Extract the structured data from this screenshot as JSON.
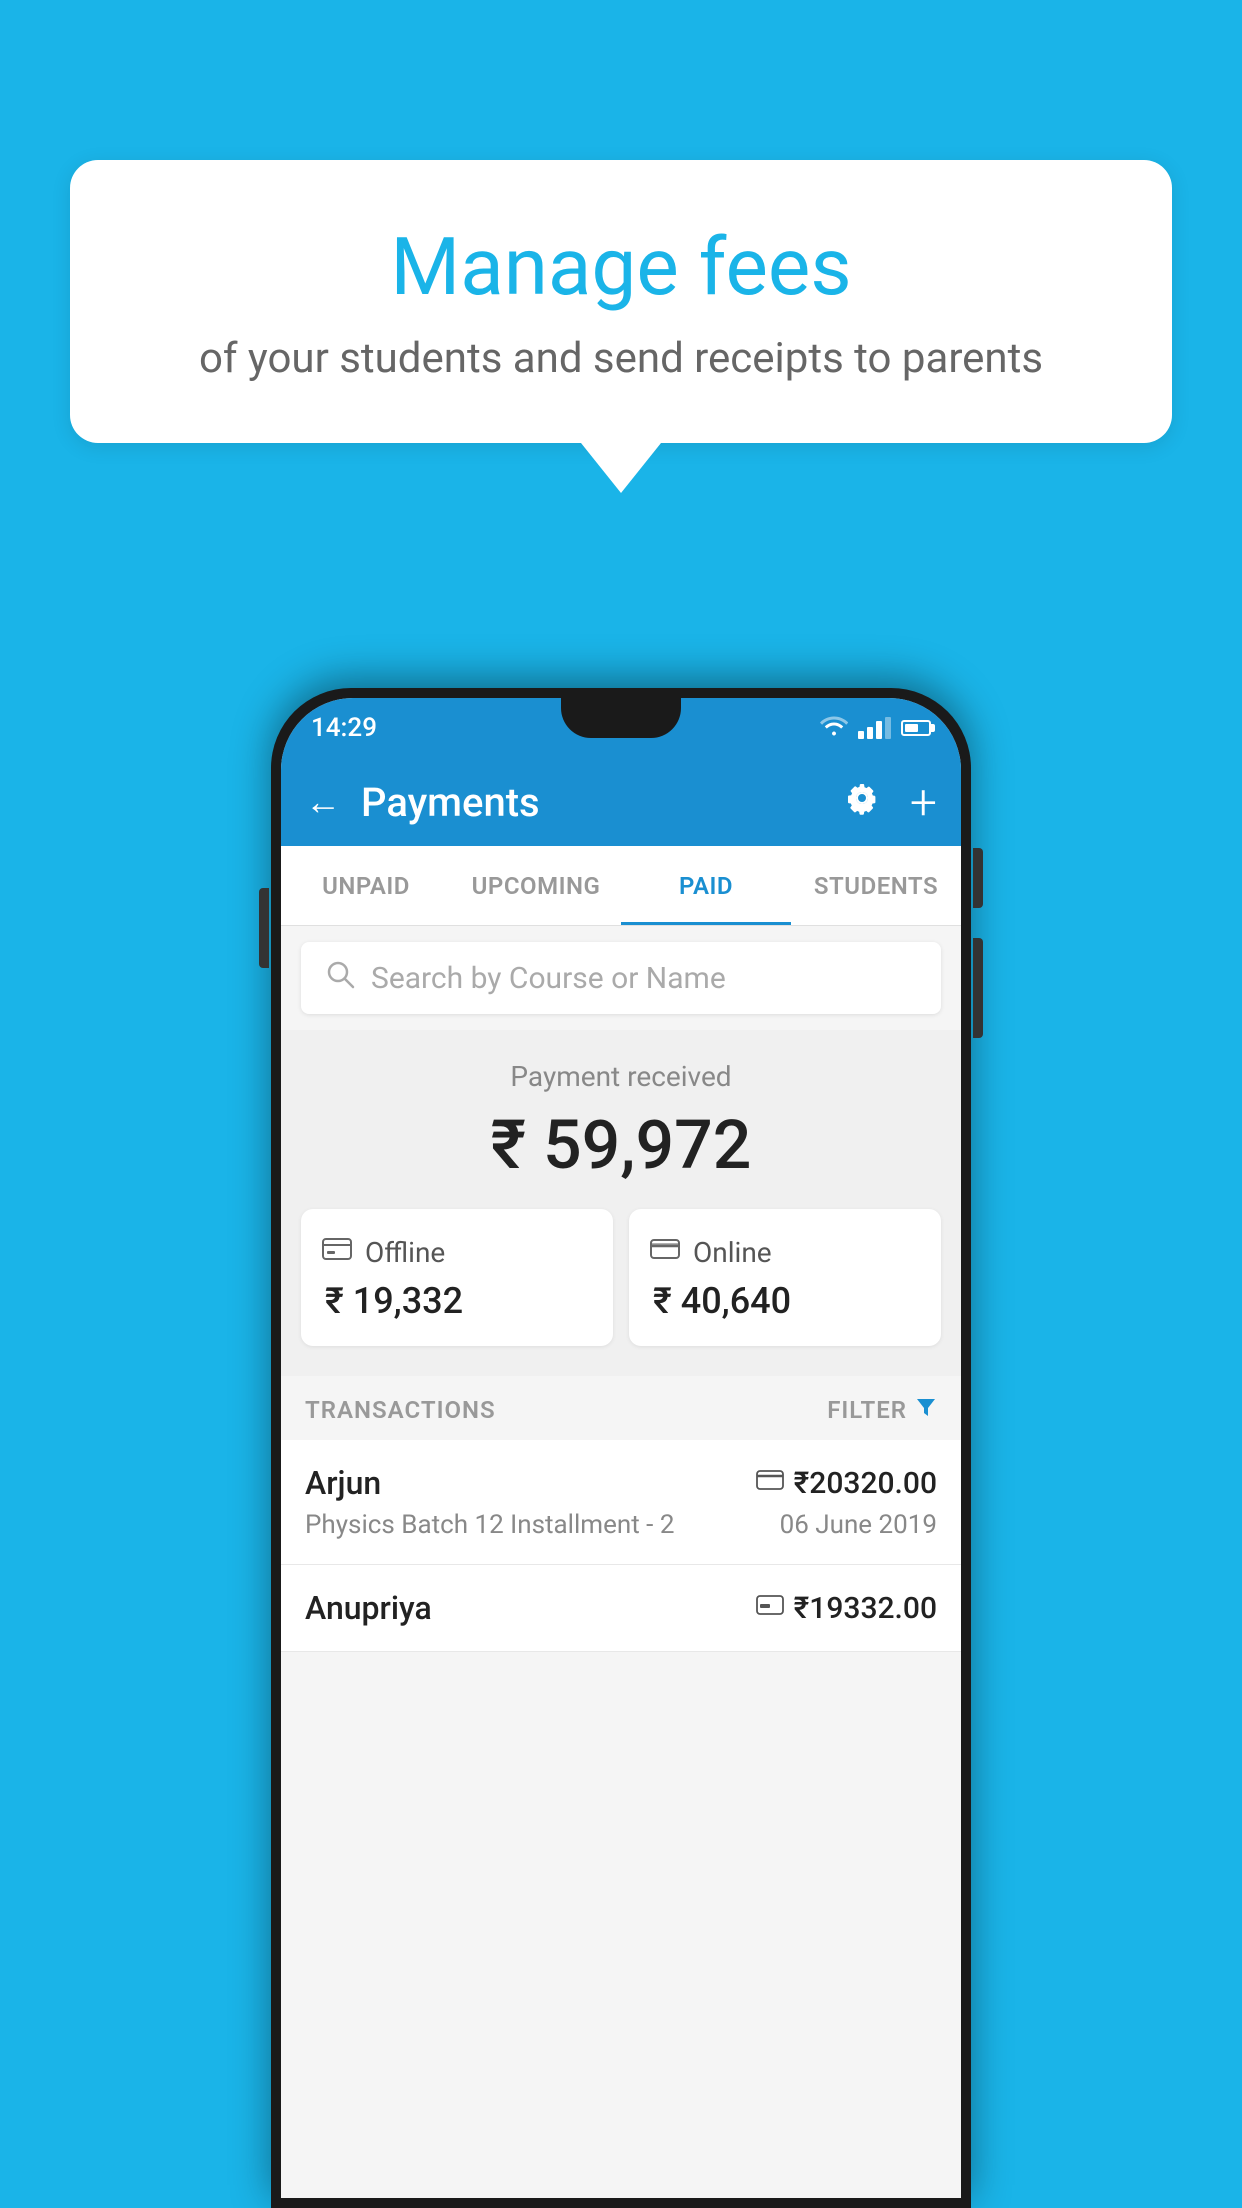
{
  "background_color": "#1ab4e8",
  "speech_bubble": {
    "title": "Manage fees",
    "subtitle": "of your students and send receipts to parents"
  },
  "status_bar": {
    "time": "14:29"
  },
  "app_bar": {
    "title": "Payments",
    "back_label": "←",
    "settings_label": "⚙",
    "add_label": "+"
  },
  "tabs": [
    {
      "id": "unpaid",
      "label": "UNPAID",
      "active": false
    },
    {
      "id": "upcoming",
      "label": "UPCOMING",
      "active": false
    },
    {
      "id": "paid",
      "label": "PAID",
      "active": true
    },
    {
      "id": "students",
      "label": "STUDENTS",
      "active": false
    }
  ],
  "search": {
    "placeholder": "Search by Course or Name"
  },
  "payment_summary": {
    "received_label": "Payment received",
    "total_amount": "₹ 59,972",
    "offline_label": "Offline",
    "offline_amount": "₹ 19,332",
    "online_label": "Online",
    "online_amount": "₹ 40,640"
  },
  "transactions": {
    "header_label": "TRANSACTIONS",
    "filter_label": "FILTER",
    "items": [
      {
        "name": "Arjun",
        "course": "Physics Batch 12 Installment - 2",
        "amount": "₹20320.00",
        "date": "06 June 2019",
        "payment_type": "card"
      },
      {
        "name": "Anupriya",
        "course": "",
        "amount": "₹19332.00",
        "date": "",
        "payment_type": "offline"
      }
    ]
  }
}
